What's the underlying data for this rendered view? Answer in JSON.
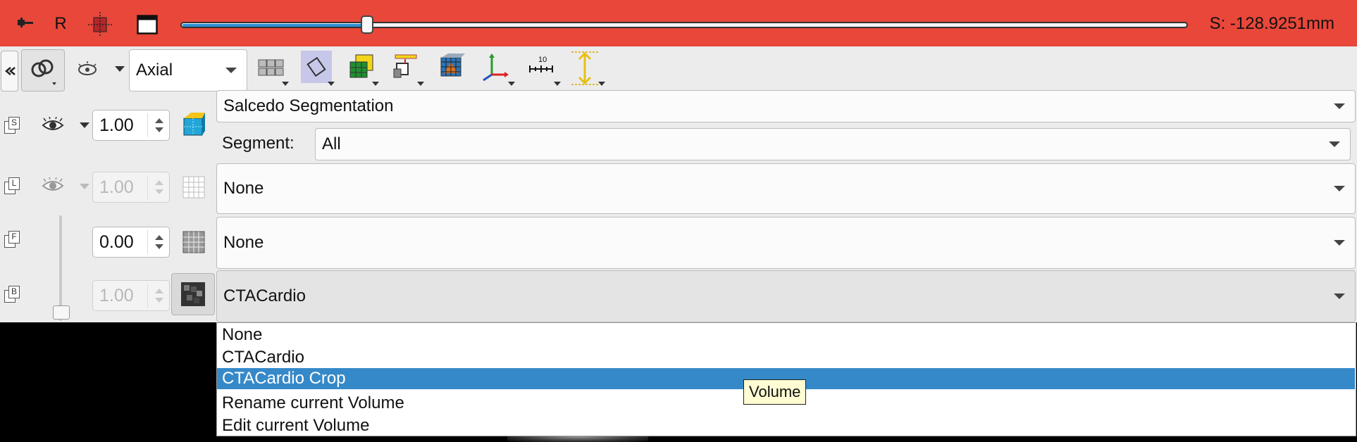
{
  "top_bar": {
    "orientation_label": "R",
    "slice_offset": "S: -128.9251mm",
    "slider_fraction": 0.185,
    "background_color": "#e8473a"
  },
  "toolbar": {
    "view_select": "Axial",
    "icons": [
      "pin-icon",
      "layout-grid-icon",
      "crosshair-icon",
      "maximize-icon",
      "link-icon",
      "eye-icon",
      "layer-grid-icon",
      "reformat-icon",
      "label-grid-icon",
      "slice-intersect-icon",
      "volume-render-icon",
      "axes-icon",
      "ruler-icon",
      "height-arrows-icon"
    ]
  },
  "layers": {
    "segmentation": {
      "opacity": "1.00",
      "node": "Salcedo Segmentation",
      "segment_label": "Segment:",
      "segment_value": "All"
    },
    "label": {
      "opacity": "1.00",
      "node": "None"
    },
    "foreground": {
      "opacity": "0.00",
      "node": "None"
    },
    "background": {
      "opacity": "1.00",
      "node": "CTACardio"
    }
  },
  "dropdown": {
    "options": [
      "None",
      "CTACardio",
      "CTACardio Crop",
      "Rename current Volume",
      "Edit current Volume"
    ],
    "selected": "CTACardio Crop",
    "highlight_color": "#3689c9"
  },
  "tooltip": "Volume"
}
